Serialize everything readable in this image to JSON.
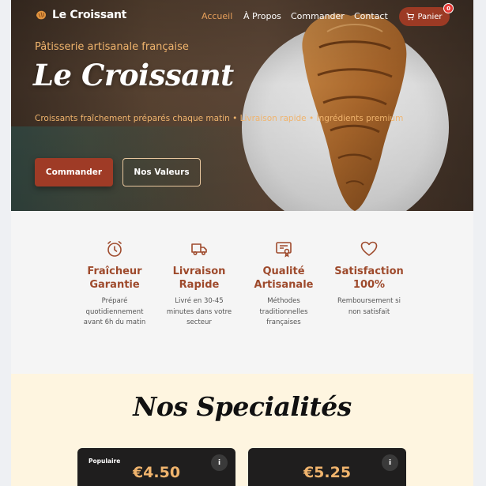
{
  "nav": {
    "brand": "Le Croissant",
    "links": [
      "Accueil",
      "À Propos",
      "Commander",
      "Contact"
    ],
    "active": "Accueil",
    "cart_label": "Panier",
    "cart_count": "0"
  },
  "hero": {
    "subtitle": "Pâtisserie artisanale française",
    "title": "Le Croissant",
    "tagline": "Croissants fraîchement préparés chaque matin • Livraison rapide • Ingrédients premium",
    "primary_button": "Commander",
    "secondary_button": "Nos Valeurs"
  },
  "features": [
    {
      "icon": "alarm-clock-icon",
      "title": "Fraîcheur Garantie",
      "desc": "Préparé quotidiennement avant 6h du matin"
    },
    {
      "icon": "delivery-truck-icon",
      "title": "Livraison Rapide",
      "desc": "Livré en 30-45 minutes dans votre secteur"
    },
    {
      "icon": "certificate-icon",
      "title": "Qualité Artisanale",
      "desc": "Méthodes traditionnelles françaises"
    },
    {
      "icon": "heart-icon",
      "title": "Satisfaction 100%",
      "desc": "Remboursement si non satisfait"
    }
  ],
  "specialites": {
    "title": "Nos Specialités",
    "cards": [
      {
        "badge": "Populaire",
        "price": "€4.50",
        "info": "i"
      },
      {
        "badge": "",
        "price": "€5.25",
        "info": "i"
      }
    ]
  },
  "colors": {
    "accent": "#9f3b26",
    "gold": "#f0b46d",
    "feature_title": "#9e4a2c",
    "cream": "#fef5e0"
  }
}
